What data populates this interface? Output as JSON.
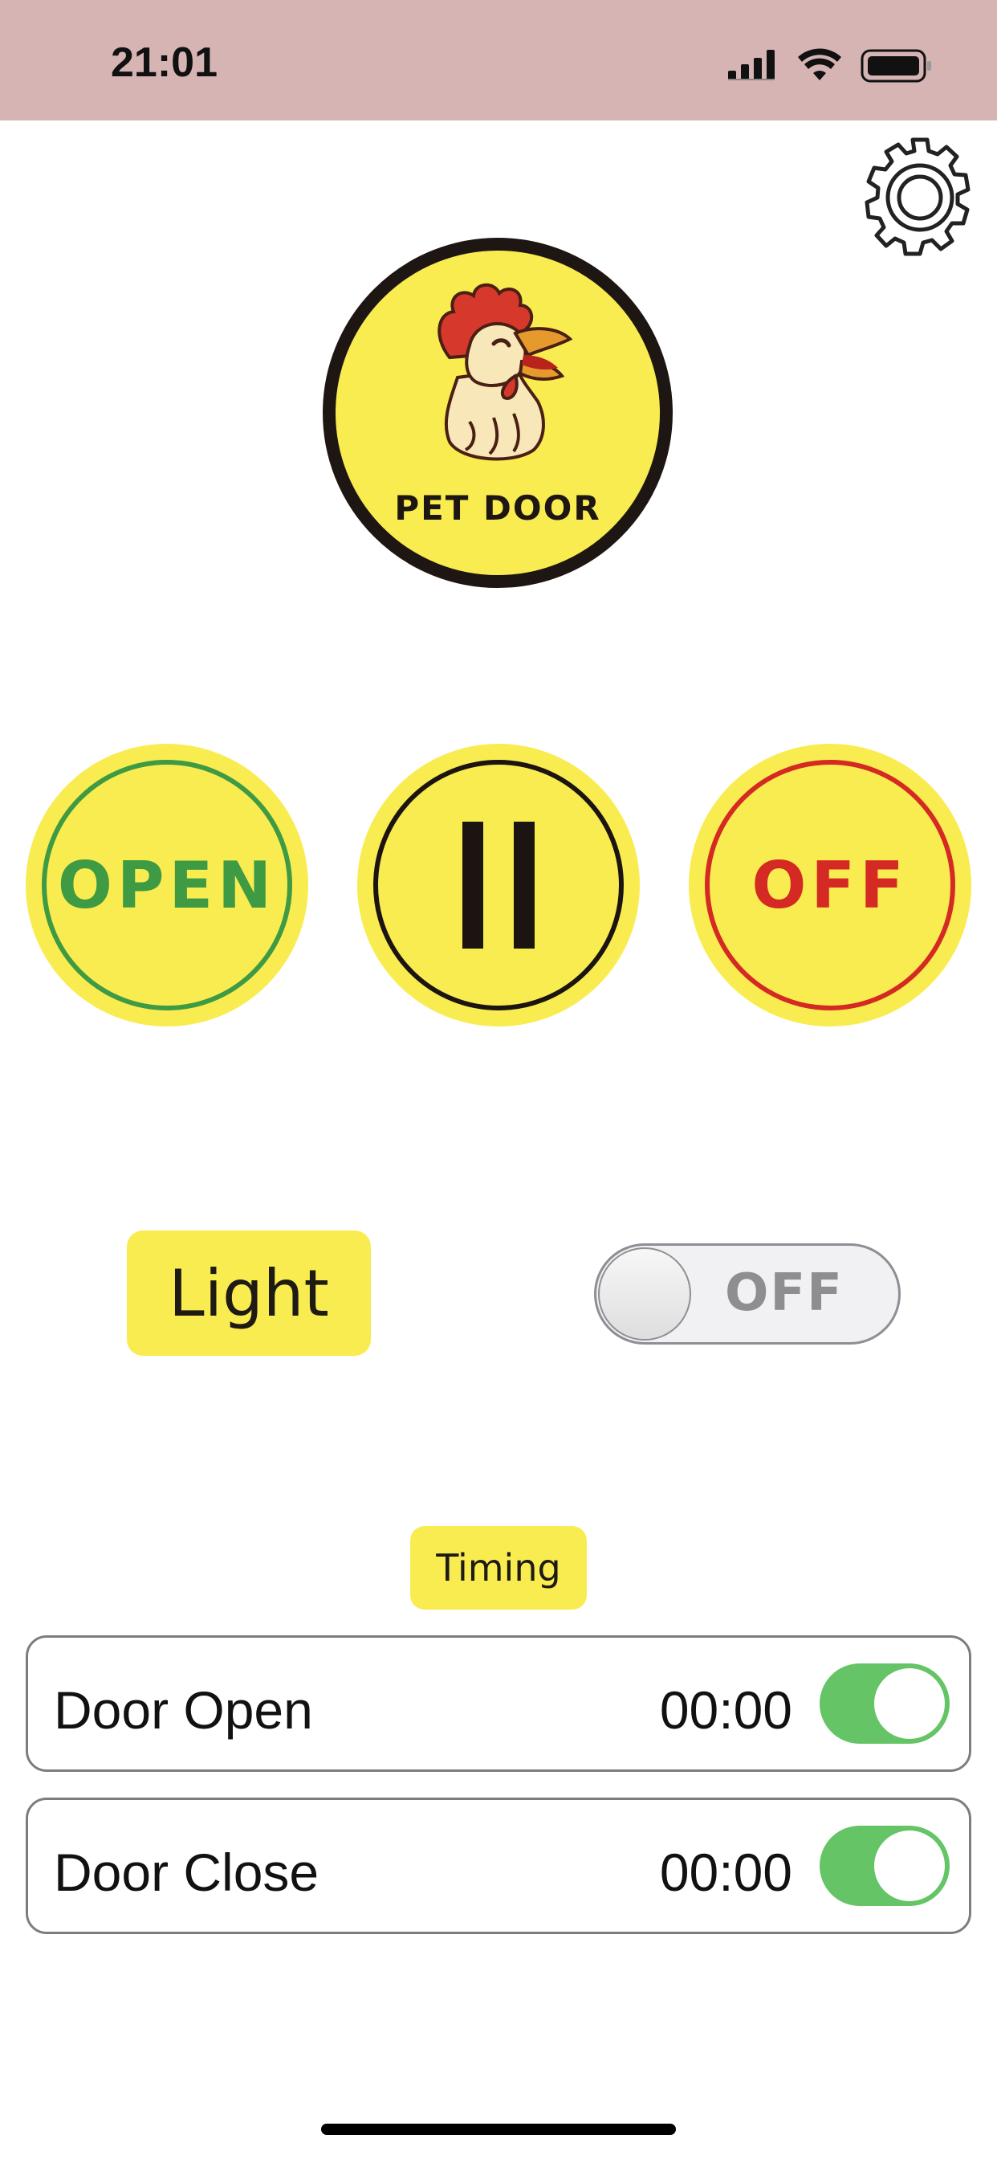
{
  "status_bar": {
    "time": "21:01",
    "icons": [
      "cellular-signal-icon",
      "wifi-icon",
      "battery-icon"
    ]
  },
  "logo": {
    "text": "PET DOOR",
    "icon": "rooster-icon"
  },
  "settings": {
    "icon": "gear-icon"
  },
  "controls": {
    "open_label": "OPEN",
    "pause_icon": "pause-icon",
    "off_label": "OFF"
  },
  "light": {
    "label": "Light",
    "toggle_state": "OFF"
  },
  "timing": {
    "label": "Timing",
    "rows": [
      {
        "name": "Door Open",
        "time": "00:00",
        "enabled": true
      },
      {
        "name": "Door Close",
        "time": "00:00",
        "enabled": true
      }
    ]
  },
  "colors": {
    "status_bar_bg": "#d6b4b4",
    "accent_yellow": "#f9ec50",
    "open_green": "#3e9a43",
    "off_red": "#d42a23",
    "switch_green": "#65c466"
  }
}
